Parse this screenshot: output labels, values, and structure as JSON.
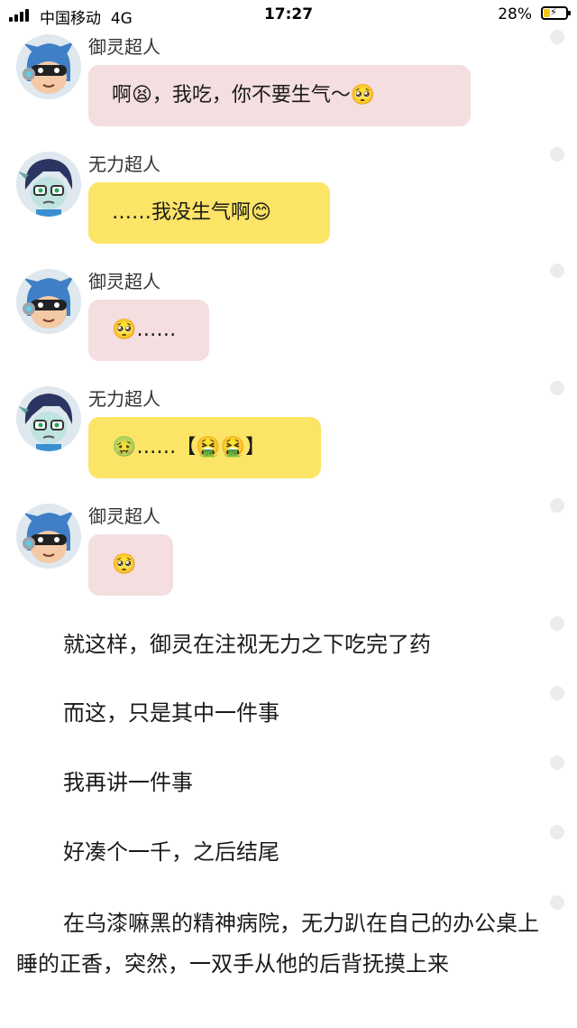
{
  "status_bar": {
    "carrier": "中国移动",
    "network": "4G",
    "time": "17:27",
    "battery": "28%",
    "battery_level": 0.28
  },
  "messages": [
    {
      "sender": "御灵超人",
      "text": "啊😫，我吃，你不要生气～🥺",
      "style": "pink",
      "avatar": "blue-hair-masked-hero"
    },
    {
      "sender": "无力超人",
      "text": "……我没生气啊😊",
      "style": "yellow",
      "avatar": "dark-hair-glasses-hero"
    },
    {
      "sender": "御灵超人",
      "text": "🥺……",
      "style": "pink",
      "avatar": "blue-hair-masked-hero"
    },
    {
      "sender": "无力超人",
      "text": "🤢……【🤮🤮】",
      "style": "yellow",
      "avatar": "dark-hair-glasses-hero"
    },
    {
      "sender": "御灵超人",
      "text": "🥺",
      "style": "pink",
      "avatar": "blue-hair-masked-hero"
    }
  ],
  "narrative": [
    "就这样，御灵在注视无力之下吃完了药",
    "而这，只是其中一件事",
    "我再讲一件事",
    "好凑个一千，之后结尾",
    "在乌漆嘛黑的精神病院，无力趴在自己的办公桌上睡的正香，突然，一双手从他的后背抚摸上来"
  ],
  "colors": {
    "pink_bubble": "#f4dee0",
    "yellow_bubble": "#fce466",
    "battery_fill": "#f5c518"
  }
}
